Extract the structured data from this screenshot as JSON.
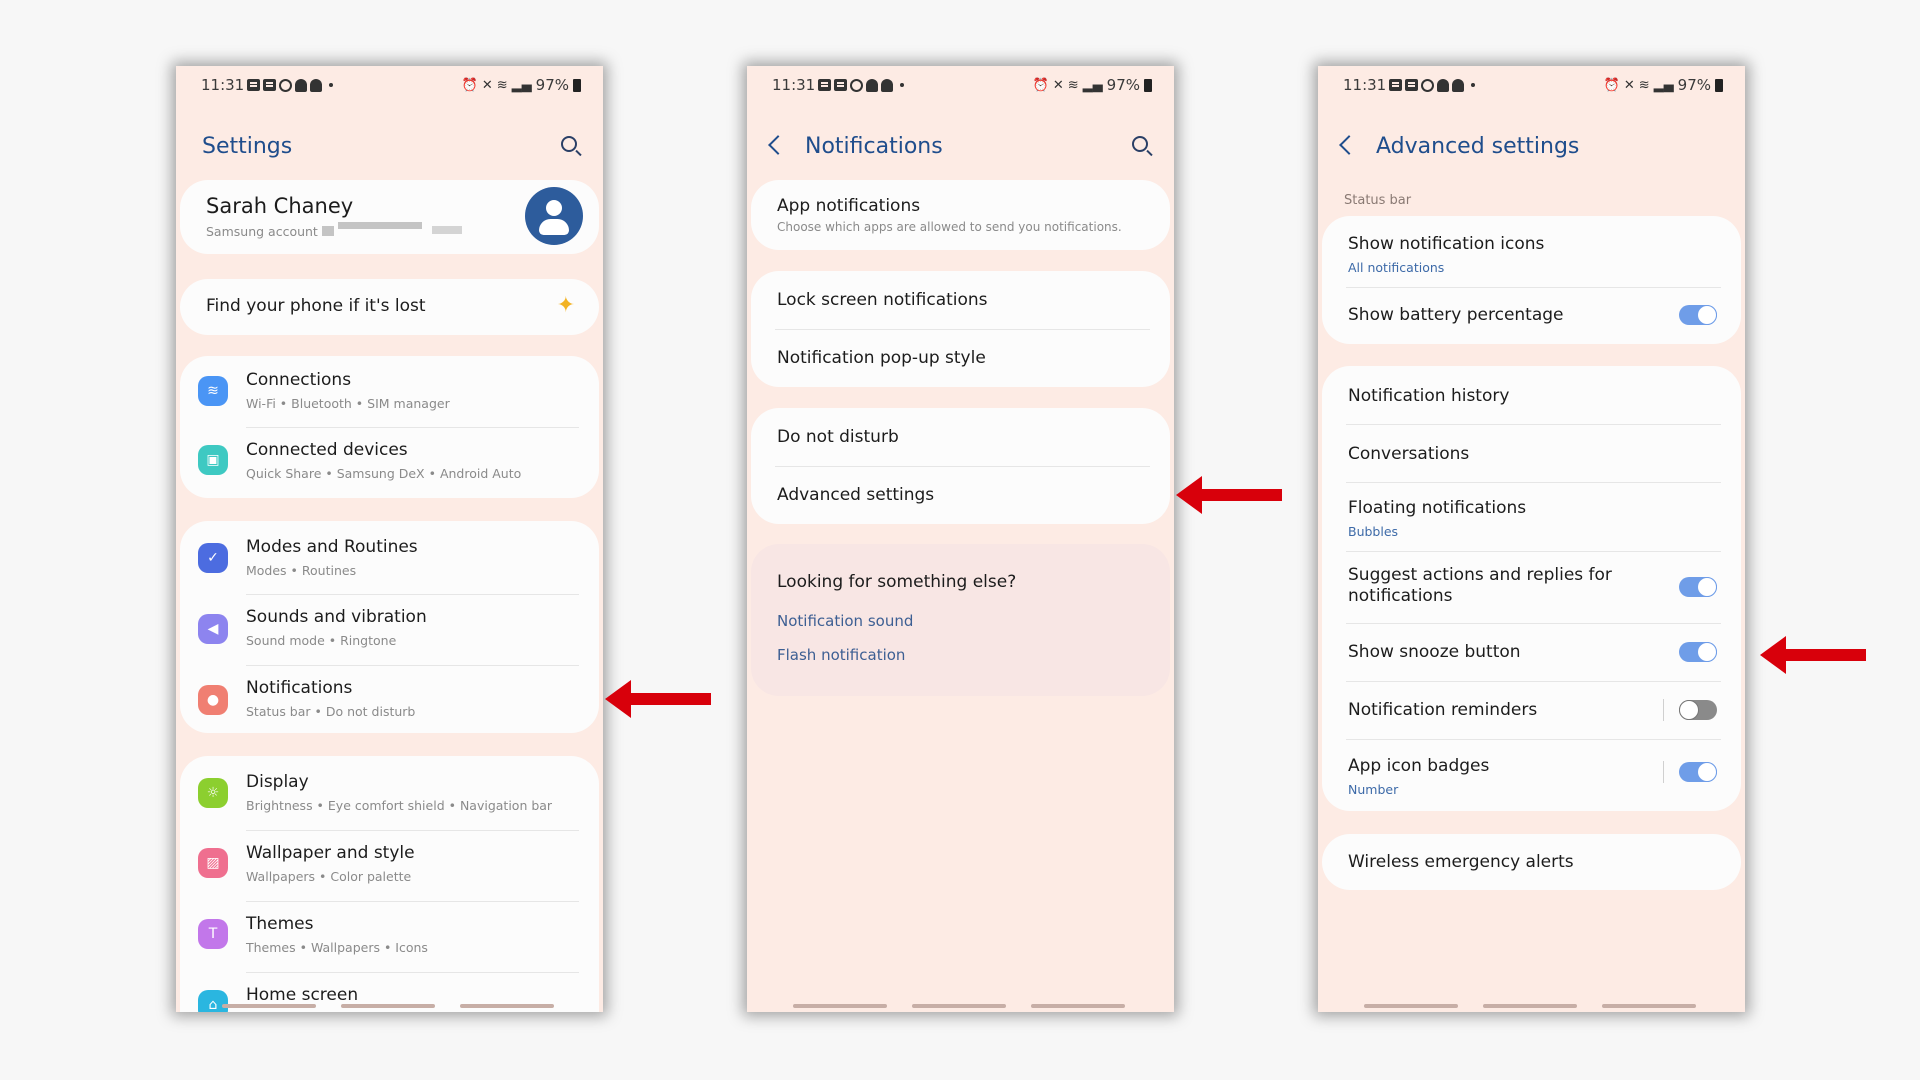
{
  "status_bar": {
    "time": "11:31",
    "battery": "97%"
  },
  "panels": {
    "settings": {
      "title": "Settings",
      "profile": {
        "name": "Sarah Chaney",
        "account_label": "Samsung account •"
      },
      "find_phone": "Find your phone if it's lost",
      "items": [
        {
          "title": "Connections",
          "sub": "Wi-Fi  •  Bluetooth  •  SIM manager",
          "color": "#4a95f5",
          "icon": "wifi-icon",
          "glyph": "≋"
        },
        {
          "title": "Connected devices",
          "sub": "Quick Share  •  Samsung DeX  •  Android Auto",
          "color": "#3ec9c2",
          "icon": "devices-icon",
          "glyph": "▣"
        },
        {
          "title": "Modes and Routines",
          "sub": "Modes  •  Routines",
          "color": "#4c6ce0",
          "icon": "routines-icon",
          "glyph": "✓"
        },
        {
          "title": "Sounds and vibration",
          "sub": "Sound mode  •  Ringtone",
          "color": "#8d84ef",
          "icon": "sound-icon",
          "glyph": "◀"
        },
        {
          "title": "Notifications",
          "sub": "Status bar  •  Do not disturb",
          "color": "#f07f72",
          "icon": "notifications-icon",
          "glyph": "●"
        },
        {
          "title": "Display",
          "sub": "Brightness  •  Eye comfort shield  •  Navigation bar",
          "color": "#8ccf2f",
          "icon": "display-icon",
          "glyph": "☼"
        },
        {
          "title": "Wallpaper and style",
          "sub": "Wallpapers  •  Color palette",
          "color": "#ef6f8f",
          "icon": "wallpaper-icon",
          "glyph": "▨"
        },
        {
          "title": "Themes",
          "sub": "Themes  •  Wallpapers  •  Icons",
          "color": "#c277ea",
          "icon": "themes-icon",
          "glyph": "T"
        },
        {
          "title": "Home screen",
          "sub": "",
          "color": "#2ab6e0",
          "icon": "home-screen-icon",
          "glyph": "⌂"
        }
      ]
    },
    "notifications": {
      "title": "Notifications",
      "app_notifications": {
        "title": "App notifications",
        "sub": "Choose which apps are allowed to send you notifications."
      },
      "lock_screen": "Lock screen notifications",
      "popup_style": "Notification pop-up style",
      "dnd": "Do not disturb",
      "advanced": "Advanced settings",
      "looking": {
        "heading": "Looking for something else?",
        "links": [
          "Notification sound",
          "Flash notification"
        ]
      }
    },
    "advanced": {
      "title": "Advanced settings",
      "section_label": "Status bar",
      "show_icons": {
        "title": "Show notification icons",
        "sub": "All notifications"
      },
      "battery_pct": {
        "title": "Show battery percentage",
        "on": true
      },
      "history": "Notification history",
      "conversations": "Conversations",
      "floating": {
        "title": "Floating notifications",
        "sub": "Bubbles"
      },
      "suggest": {
        "title_1": "Suggest actions and replies for",
        "title_2": "notifications",
        "on": true
      },
      "snooze": {
        "title": "Show snooze button",
        "on": true
      },
      "reminders": {
        "title": "Notification reminders",
        "on": false
      },
      "badges": {
        "title": "App icon badges",
        "sub": "Number",
        "on": true
      },
      "emergency": "Wireless emergency alerts"
    }
  },
  "colors": {
    "accent_blue": "#1f4d8c",
    "arrow_red": "#d8000b",
    "toggle_on": "#6f9de8"
  }
}
